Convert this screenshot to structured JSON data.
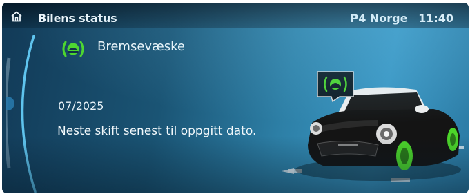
{
  "header": {
    "title": "Bilens status",
    "radio_station": "P4 Norge",
    "clock": "11:40"
  },
  "warning": {
    "title": "Bremsevæske",
    "date": "07/2025",
    "message": "Neste skift senest til oppgitt dato.",
    "icon": "brake-fluid-icon",
    "icon_color": "#4cd62a"
  },
  "colors": {
    "accent_arc": "#5fc4ee",
    "warning_green": "#4cd62a",
    "background": "#1f6088"
  }
}
